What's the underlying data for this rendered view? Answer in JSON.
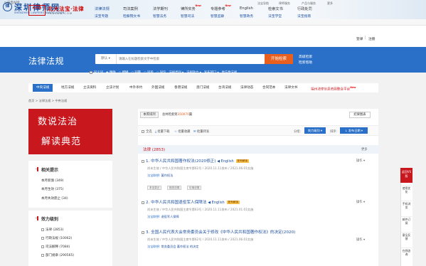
{
  "top_banner": {
    "logo_char": "律",
    "title": "深圳律师网",
    "subtitle": "SHENZHEN LAWYERS ASSOCIATION",
    "links": [
      "法宝导航",
      "律师服务",
      "产品与服务",
      "更多"
    ],
    "search_select": "选择检索"
  },
  "app_bar": {
    "label": "法宝APP"
  },
  "header": {
    "logo_text": "北大法宝",
    "site_name": "北大法宝·法律",
    "domain": "PKULAW.COM",
    "nav": [
      {
        "top": "法律法规",
        "bottom": "法宝专题",
        "new": false
      },
      {
        "top": "司法案例",
        "bottom": "检察院文书",
        "new": false
      },
      {
        "top": "法学期刊",
        "bottom": "智慧法务",
        "new": false
      },
      {
        "top": "律所实务",
        "bottom": "智慧司法",
        "new": true
      },
      {
        "top": "专题参考",
        "bottom": "智慧监察",
        "new": true
      },
      {
        "top": "English",
        "bottom": "智慧政务",
        "new": false
      },
      {
        "top": "检索文书",
        "bottom": "法宝学堂",
        "new": false
      },
      {
        "top": "行政处罚",
        "bottom": "法宝指南",
        "new": false
      }
    ],
    "login": "登录",
    "register": "注册"
  },
  "hero": {
    "title": "法律法规",
    "scope": "默认",
    "placeholder": "请输入在标题检索文字中检索",
    "search_button": "开始检索",
    "advanced": "高级检索",
    "help": "检索帮助",
    "filters": [
      "同义词",
      "精确",
      "模糊",
      "同篇",
      "同段",
      "同句",
      "法规类别",
      "法规效力",
      "发布部门",
      "地方性法规"
    ]
  },
  "tabs": [
    "中央法规",
    "地方法规",
    "立法资料",
    "立法计划",
    "中外条约",
    "外国法规",
    "香港法规",
    "澳门法规",
    "台湾法规",
    "法律动态",
    "合同范本",
    "法律文书",
    "福州法律信息资源整合平台"
  ],
  "breadcrumb": "首页 > 法律法规 > 中央法规",
  "promo": {
    "line1": "数说法治",
    "line2": "解读典范"
  },
  "hint_panel": {
    "title": "相关提示",
    "items": [
      "本月新颁 (349)",
      "本月生效 (375)",
      "本月失效废止 (34)"
    ]
  },
  "level_panel": {
    "title": "效力级别",
    "items": [
      "法律 (2853)",
      "行政法规 (10062)",
      "司法解释 (7084)",
      "部门规章 (290565)"
    ]
  },
  "results": {
    "sort_tab": "本库排列",
    "count_prefix": "总共检索到",
    "count_value": "350070",
    "count_suffix": "篇",
    "compare": "结果图表",
    "toolbar": [
      "全选",
      "批量下载",
      "批量收藏",
      "批量转发"
    ],
    "group_label": "分组:",
    "group_value": "效力级别",
    "sort_label": "排序:",
    "sort_value": "发布日期",
    "group_title": "法律 (2853)",
    "more": "更多",
    "items": [
      {
        "title": "1. 中华人民共和国著作权法(2020修正)",
        "english": "English",
        "badge": "配有解读",
        "meta": "尚未生效 / 中华人民共和国主席令第62号 / 2020.11.11发布 / 2021.06.01实施",
        "keys_label": "法宝联想:",
        "keys": "著作权法",
        "tags": [
          "本法变迁",
          "相关法规",
          "引用法规"
        ],
        "op": "操作"
      },
      {
        "title": "2. 中华人民共和国退役军人保障法",
        "english": "English",
        "badge": "配有解读",
        "meta": "尚未生效 / 中华人民共和国主席令第63号 / 2020.11.11发布 / 2021.01.01实施",
        "keys_label": "法宝联想:",
        "keys": "退役军人保障",
        "tags": [],
        "op": "操作"
      },
      {
        "title": "3. 全国人民代表大会常务委员会关于修改《中华人民共和国著作权法》的决定(2020)",
        "english": "",
        "badge": "",
        "meta": "尚未生效 / 中华人民共和国主席令第62号 / 2020.11.11发布 / 2021.06.01实施",
        "keys_label": "法宝联想:",
        "keys": "常务委员会  著作权法  的决定",
        "tags": [],
        "op": "操作"
      }
    ]
  },
  "right_rail": {
    "back": "返回VS版",
    "items": [
      "使用优化",
      "手机浏览",
      "邮件订阅",
      "意见反馈",
      "在线咨询"
    ]
  },
  "colors": {
    "brand_blue": "#2a70c8",
    "brand_red": "#c9171e",
    "accent_orange": "#e9601e"
  }
}
